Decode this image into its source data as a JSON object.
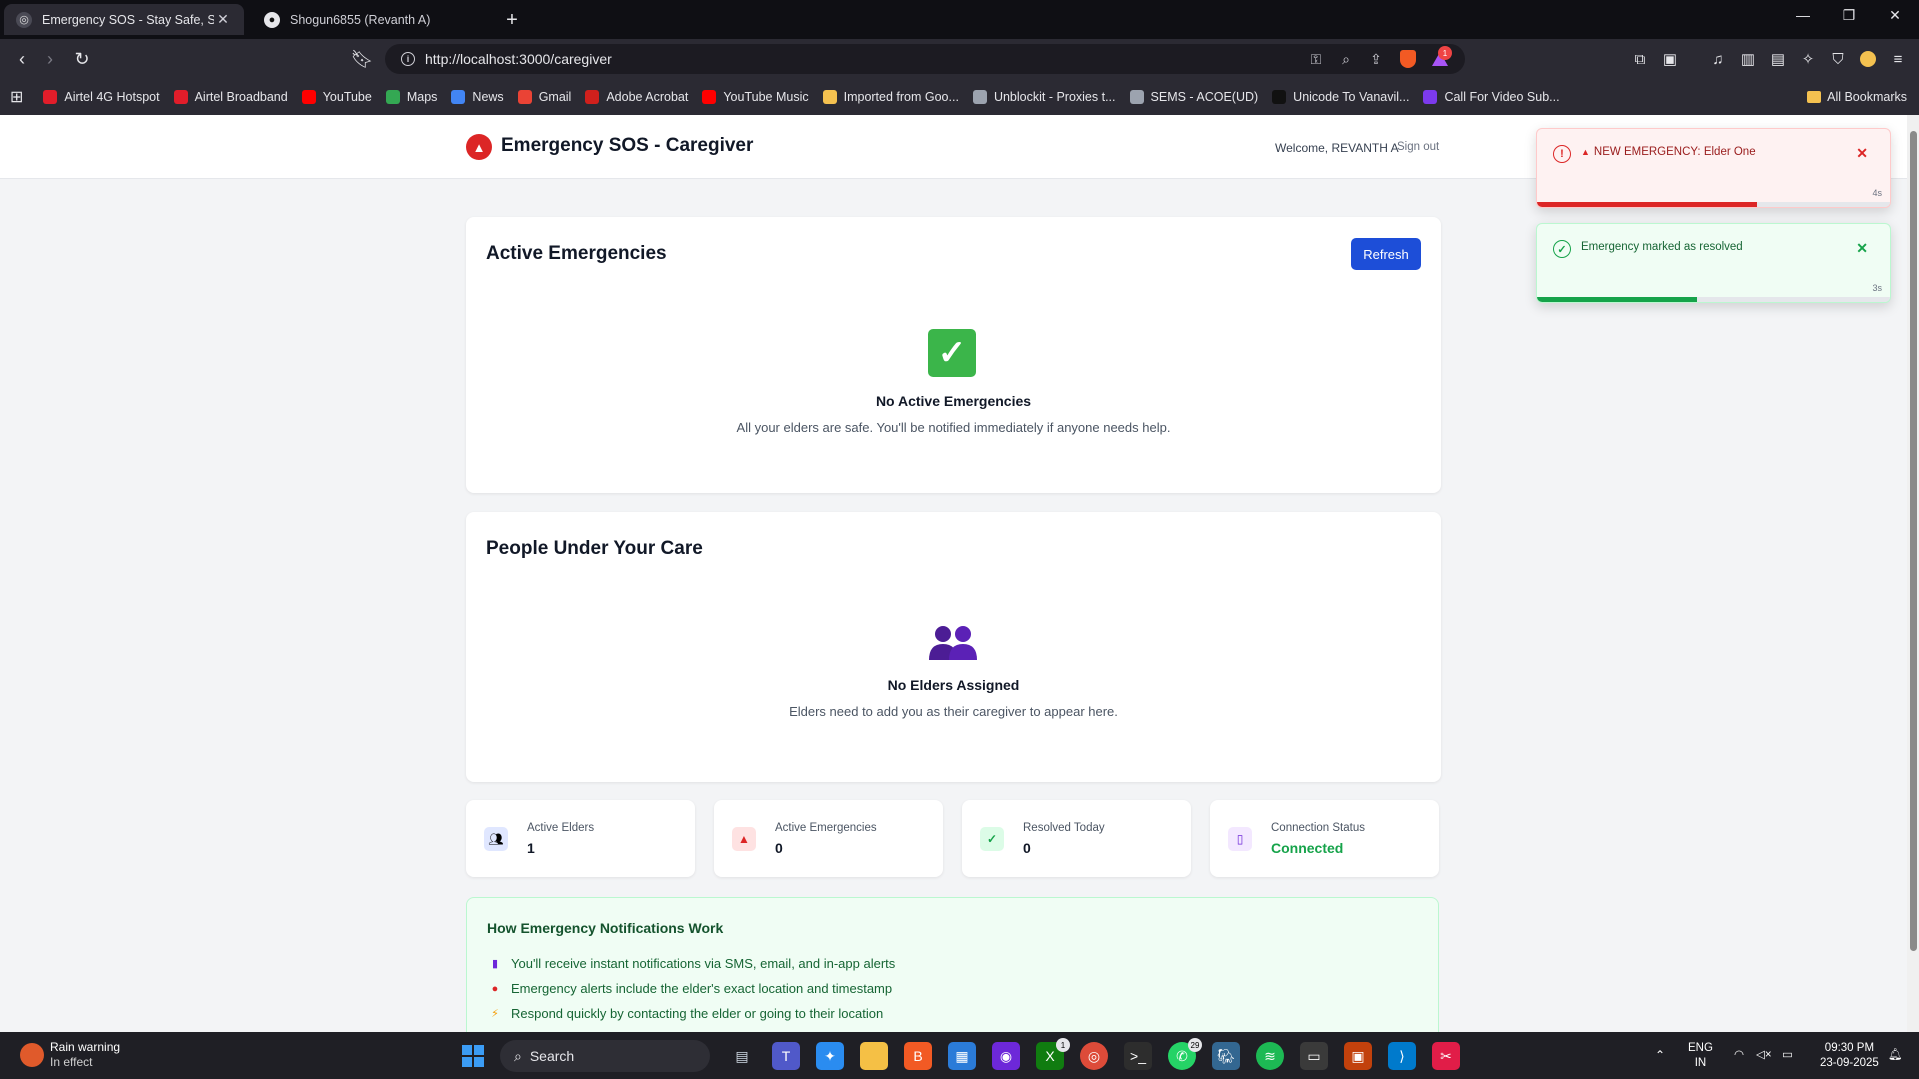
{
  "browser": {
    "tabs": [
      {
        "title": "Emergency SOS - Stay Safe, Stay",
        "active": true
      },
      {
        "title": "Shogun6855 (Revanth A)",
        "active": false
      }
    ],
    "url": "http://localhost:3000/caregiver",
    "bookmarks": [
      {
        "label": "Airtel 4G Hotspot",
        "color": "#e11d2a"
      },
      {
        "label": "Airtel Broadband",
        "color": "#e11d2a"
      },
      {
        "label": "YouTube",
        "color": "#ff0000"
      },
      {
        "label": "Maps",
        "color": "#34a853"
      },
      {
        "label": "News",
        "color": "#4285f4"
      },
      {
        "label": "Gmail",
        "color": "#ea4335"
      },
      {
        "label": "Adobe Acrobat",
        "color": "#d0201c"
      },
      {
        "label": "YouTube Music",
        "color": "#ff0000"
      },
      {
        "label": "Imported from Goo...",
        "color": "#f4c150"
      },
      {
        "label": "Unblockit - Proxies t...",
        "color": "#9ca3af"
      },
      {
        "label": "SEMS - ACOE(UD)",
        "color": "#9ca3af"
      },
      {
        "label": "Unicode To Vanavil...",
        "color": "#111111"
      },
      {
        "label": "Call For Video Sub...",
        "color": "#7c3aed"
      }
    ],
    "all_bookmarks": "All Bookmarks",
    "shield_badge": "1"
  },
  "header": {
    "title": "Emergency SOS - Caregiver",
    "welcome": "Welcome, REVANTH A",
    "signout": "Sign out"
  },
  "emergencies": {
    "title": "Active Emergencies",
    "refresh": "Refresh",
    "empty_title": "No Active Emergencies",
    "empty_sub": "All your elders are safe. You'll be notified immediately if anyone needs help."
  },
  "people": {
    "title": "People Under Your Care",
    "empty_title": "No Elders Assigned",
    "empty_sub": "Elders need to add you as their caregiver to appear here."
  },
  "stats": [
    {
      "label": "Active Elders",
      "value": "1",
      "icon": "people-icon",
      "bg": "#e0e7ff"
    },
    {
      "label": "Active Emergencies",
      "value": "0",
      "icon": "siren-icon",
      "bg": "#fee2e2"
    },
    {
      "label": "Resolved Today",
      "value": "0",
      "icon": "check-icon",
      "bg": "#dcfce7"
    },
    {
      "label": "Connection Status",
      "value": "Connected",
      "icon": "phone-icon",
      "bg": "#f3e8ff",
      "value_color": "#16a34a"
    }
  ],
  "info": {
    "title": "How Emergency Notifications Work",
    "items": [
      "You'll receive instant notifications via SMS, email, and in-app alerts",
      "Emergency alerts include the elder's exact location and timestamp",
      "Respond quickly by contacting the elder or going to their location"
    ]
  },
  "toasts": [
    {
      "message": "NEW EMERGENCY: Elder One",
      "time": "4s",
      "progress": 0.62,
      "color": "#dc2626",
      "text_color": "#991b1b"
    },
    {
      "message": "Emergency marked as resolved",
      "time": "3s",
      "progress": 0.45,
      "color": "#16a34a",
      "text_color": "#166534"
    }
  ],
  "taskbar": {
    "weather_title": "Rain warning",
    "weather_sub": "In effect",
    "search": "Search",
    "lang": "ENG",
    "region": "IN",
    "time": "09:30 PM",
    "date": "23-09-2025",
    "xbox_badge": "1",
    "whatsapp_badge": "29"
  }
}
